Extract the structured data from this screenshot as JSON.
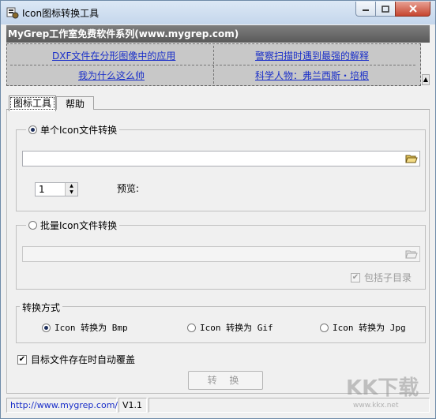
{
  "window": {
    "title": "Icon图标转换工具"
  },
  "banner": {
    "text": "MyGrep工作室免费软件系列(www.mygrep.com)"
  },
  "links": [
    {
      "label": "DXF文件在分形图像中的应用"
    },
    {
      "label": "警察扫描时遇到最强的解释"
    },
    {
      "label": "我为什么这么帅"
    },
    {
      "label": "科学人物：弗兰西斯・培根"
    }
  ],
  "tabs": [
    {
      "label": "图标工具",
      "active": true
    },
    {
      "label": "帮助",
      "active": false
    }
  ],
  "single_convert": {
    "label": "单个Icon文件转换",
    "selected": true,
    "file_path": "",
    "index_value": "1",
    "preview_label": "预览:"
  },
  "batch_convert": {
    "label": "批量Icon文件转换",
    "selected": false,
    "folder_path": "",
    "include_subdirs_label": "包括子目录",
    "include_subdirs_checked": true
  },
  "convert_mode": {
    "label": "转换方式",
    "options": [
      {
        "label": "Icon 转换为 Bmp",
        "selected": true
      },
      {
        "label": "Icon 转换为 Gif",
        "selected": false
      },
      {
        "label": "Icon 转换为 Jpg",
        "selected": false
      }
    ]
  },
  "overwrite": {
    "label": "目标文件存在时自动覆盖",
    "checked": true
  },
  "convert_button": {
    "label": "转 换"
  },
  "status_bar": {
    "url": "http://www.mygrep.com/",
    "version": "V1.1"
  },
  "watermark": {
    "text": "KK下载",
    "sub": "www.kkx.net"
  },
  "colors": {
    "link": "#1a2fc9",
    "banner_bg": "#6a6a6a",
    "links_bg": "#c8c8c8"
  }
}
